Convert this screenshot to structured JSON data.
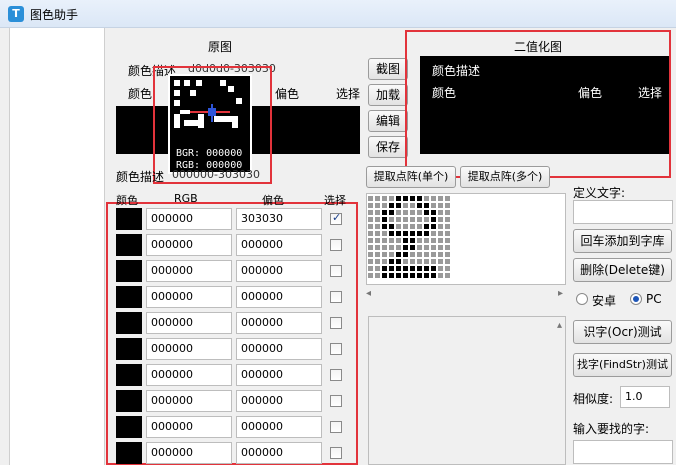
{
  "window": {
    "title": "图色助手",
    "icon_letter": "T"
  },
  "original": {
    "title": "原图",
    "color_desc_label": "颜色描述",
    "color_desc_value": "d0d0d0-303030",
    "color_label": "颜色",
    "bias_label": "偏色",
    "select_label": "选择",
    "magnifier": {
      "bgr_label": "BGR:",
      "bgr_value": "000000",
      "rgb_label": "RGB:",
      "rgb_value": "000000"
    },
    "color_desc_label2": "颜色描述",
    "color_desc_value2": "000000-303030"
  },
  "side_buttons": {
    "screenshot": "截图",
    "load": "加载",
    "edit": "编辑",
    "save": "保存"
  },
  "binary": {
    "title": "二值化图",
    "color_desc_label": "颜色描述",
    "color_label": "颜色",
    "bias_label": "偏色",
    "select_label": "选择"
  },
  "extract": {
    "single": "提取点阵(单个)",
    "multi": "提取点阵(多个)"
  },
  "table": {
    "headers": {
      "color": "颜色",
      "rgb": "RGB",
      "bias": "偏色",
      "select": "选择"
    },
    "rows": [
      {
        "rgb": "000000",
        "bias": "303030",
        "checked": true
      },
      {
        "rgb": "000000",
        "bias": "000000",
        "checked": false
      },
      {
        "rgb": "000000",
        "bias": "000000",
        "checked": false
      },
      {
        "rgb": "000000",
        "bias": "000000",
        "checked": false
      },
      {
        "rgb": "000000",
        "bias": "000000",
        "checked": false
      },
      {
        "rgb": "000000",
        "bias": "000000",
        "checked": false
      },
      {
        "rgb": "000000",
        "bias": "000000",
        "checked": false
      },
      {
        "rgb": "000000",
        "bias": "000000",
        "checked": false
      },
      {
        "rgb": "000000",
        "bias": "000000",
        "checked": false
      },
      {
        "rgb": "000000",
        "bias": "000000",
        "checked": false
      }
    ]
  },
  "right": {
    "define_text_label": "定义文字:",
    "enter_add_button": "回车添加到字库",
    "delete_button": "删除(Delete键)",
    "radio_android": "安卓",
    "radio_pc": "PC",
    "ocr_button": "识字(Ocr)测试",
    "findstr_button": "找字(FindStr)测试",
    "similarity_label": "相似度:",
    "similarity_value": "1.0",
    "input_find_label": "输入要找的字:"
  },
  "scroll": {
    "left_arrow": "◂",
    "right_arrow": "▸",
    "up_arrow": "▴"
  },
  "colors": {
    "highlight_red": "#e2333b",
    "panel_bg": "#f0f0f0"
  }
}
